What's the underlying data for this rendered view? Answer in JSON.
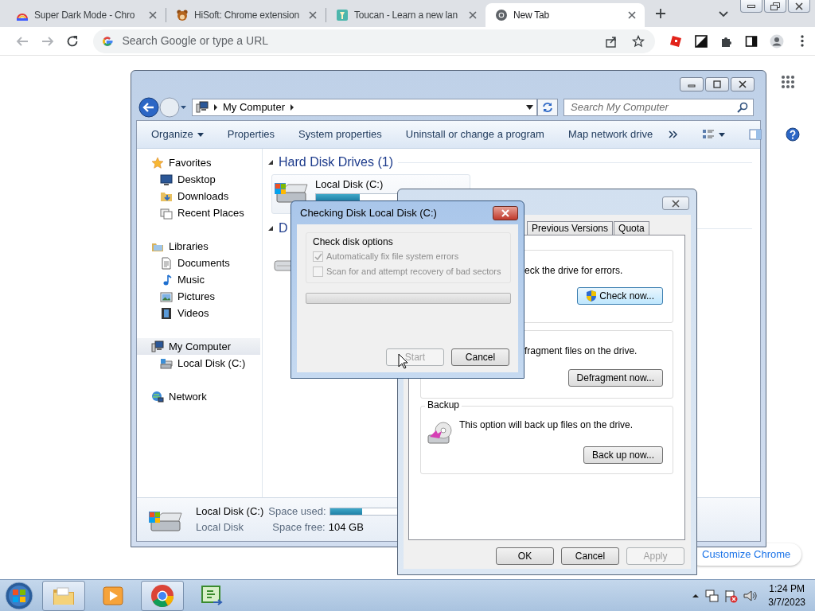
{
  "browser": {
    "tabs": [
      {
        "title": "Super Dark Mode - Chro",
        "kind": "rainbow",
        "selected": false
      },
      {
        "title": "HiSoft: Chrome extension",
        "kind": "animal",
        "selected": false
      },
      {
        "title": "Toucan - Learn a new lan",
        "kind": "square",
        "selected": false
      },
      {
        "title": "New Tab",
        "kind": "circle",
        "selected": true
      }
    ],
    "omnibox": {
      "placeholder": "Search Google or type a URL"
    },
    "customize": "Customize Chrome"
  },
  "explorer": {
    "address": "My Computer",
    "search": {
      "placeholder": "Search My Computer"
    },
    "toolbar": [
      {
        "label": "Organize",
        "dropdown": true
      },
      {
        "label": "Properties",
        "dropdown": false
      },
      {
        "label": "System properties",
        "dropdown": false
      },
      {
        "label": "Uninstall or change a program",
        "dropdown": false
      },
      {
        "label": "Map network drive",
        "dropdown": false
      }
    ],
    "nav": [
      {
        "label": "Favorites",
        "kind": "star",
        "selected": false,
        "children": [
          {
            "label": "Desktop",
            "kind": "desktop",
            "selected": false
          },
          {
            "label": "Downloads",
            "kind": "downloads",
            "selected": false
          },
          {
            "label": "Recent Places",
            "kind": "recent",
            "selected": false
          }
        ]
      },
      {
        "label": "Libraries",
        "kind": "library",
        "selected": false,
        "children": [
          {
            "label": "Documents",
            "kind": "document",
            "selected": false
          },
          {
            "label": "Music",
            "kind": "music",
            "selected": false
          },
          {
            "label": "Pictures",
            "kind": "pictures",
            "selected": false
          },
          {
            "label": "Videos",
            "kind": "videos",
            "selected": false
          }
        ]
      },
      {
        "label": "My Computer",
        "kind": "computer",
        "selected": true,
        "children": [
          {
            "label": "Local Disk (C:)",
            "kind": "drive",
            "selected": false
          }
        ]
      },
      {
        "label": "Network",
        "kind": "network",
        "selected": false
      }
    ],
    "groups": [
      {
        "title": "Hard Disk Drives (1)",
        "expanded": true
      },
      {
        "title": "D",
        "expanded": true
      }
    ],
    "drive": {
      "name": "Local Disk (C:)",
      "level": 0.3
    },
    "details": {
      "name": "Local Disk (C:)",
      "type": "Local Disk",
      "used_label": "Space used:",
      "free_label": "Space free:",
      "free": "104 GB",
      "level": 0.29
    }
  },
  "properties": {
    "tabs": [
      {
        "label": "Previous Versions",
        "selected": false
      },
      {
        "label": "Quota",
        "selected": false
      }
    ],
    "sections": [
      {
        "kind": "check",
        "text": "eck the drive for errors.",
        "button": "Check now...",
        "highlighted": true
      },
      {
        "kind": "defrag",
        "text": "fragment files on the drive.",
        "button": "Defragment now...",
        "highlighted": false
      },
      {
        "kind": "backup",
        "title": "Backup",
        "text": "This option will back up files on the drive.",
        "button": "Back up now...",
        "highlighted": false
      }
    ],
    "buttons": [
      {
        "label": "OK",
        "disabled": false
      },
      {
        "label": "Cancel",
        "disabled": false
      },
      {
        "label": "Apply",
        "disabled": true
      }
    ]
  },
  "check_dialog": {
    "title": "Checking Disk Local Disk (C:)",
    "group": "Check disk options",
    "options": [
      {
        "label": "Automatically fix file system errors",
        "checked": true,
        "disabled": true
      },
      {
        "label": "Scan for and attempt recovery of bad sectors",
        "checked": false,
        "disabled": true
      }
    ],
    "level": 0,
    "buttons": [
      {
        "label": "Start",
        "disabled": true
      },
      {
        "label": "Cancel",
        "disabled": false
      }
    ]
  },
  "taskbar": {
    "apps": [
      {
        "kind": "folder",
        "running": true
      },
      {
        "kind": "media",
        "running": false
      },
      {
        "kind": "chrome",
        "running": true
      },
      {
        "kind": "csharp",
        "running": false
      }
    ],
    "time": "1:24 PM",
    "date": "3/7/2023"
  }
}
